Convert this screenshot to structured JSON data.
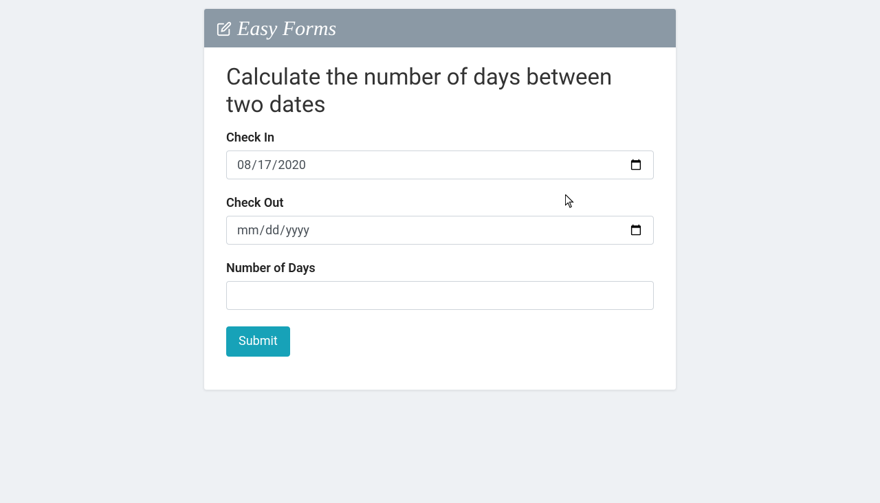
{
  "header": {
    "brand": "Easy Forms"
  },
  "form": {
    "title": "Calculate the number of days between two dates",
    "check_in_label": "Check In",
    "check_in_value": "2020-08-17",
    "check_out_label": "Check Out",
    "check_out_value": "",
    "num_days_label": "Number of Days",
    "num_days_value": "",
    "submit_label": "Submit"
  }
}
